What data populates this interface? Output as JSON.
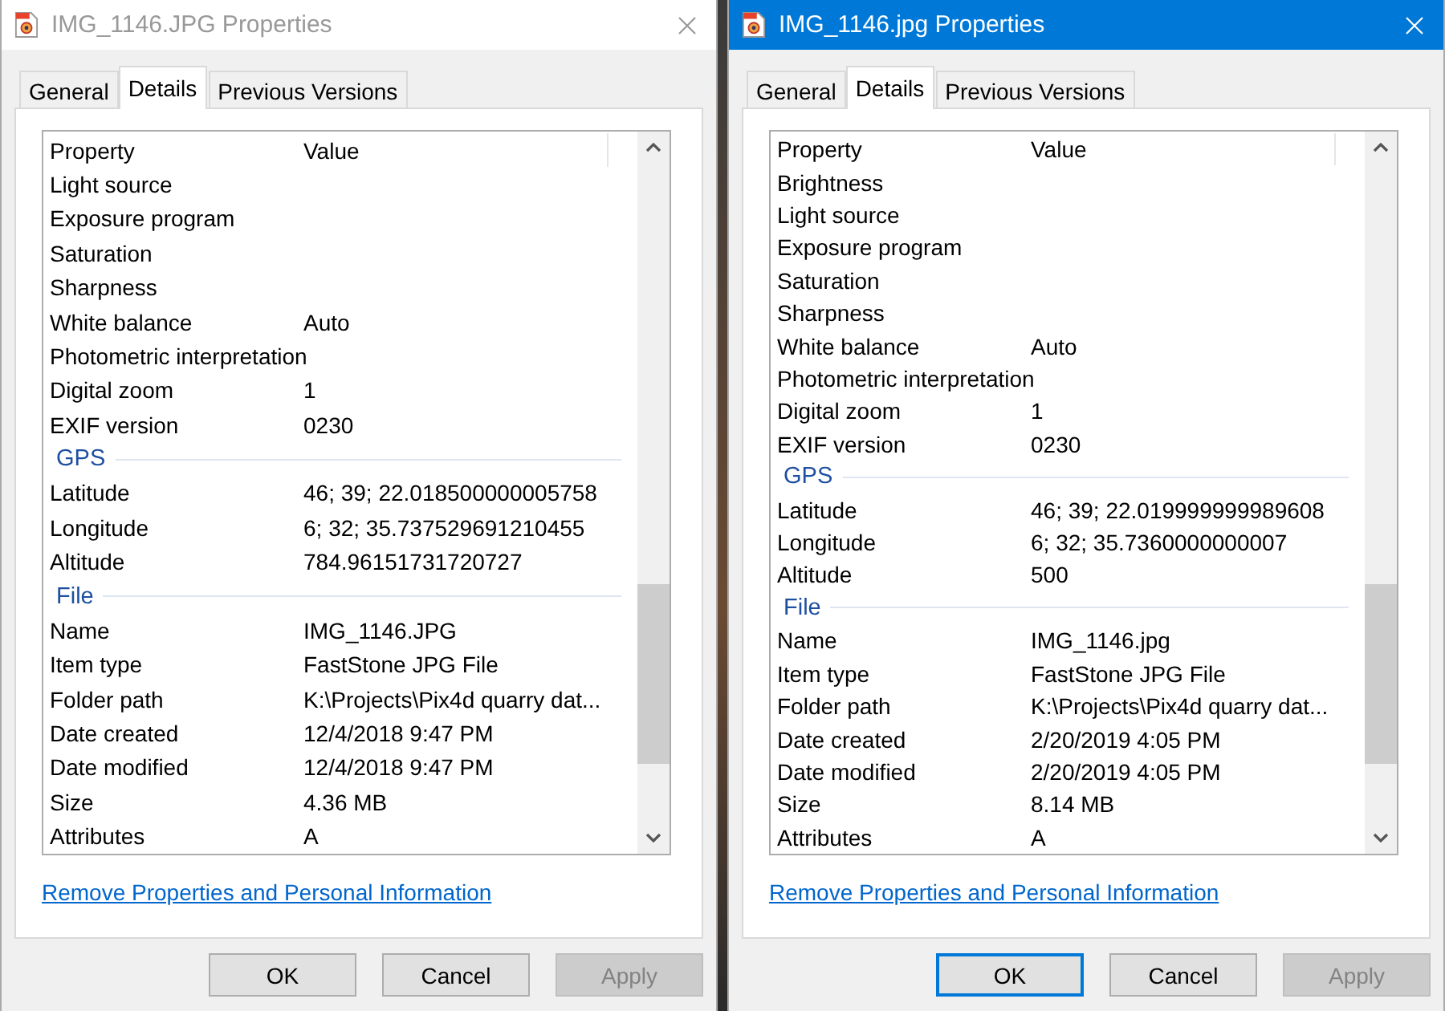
{
  "windows": [
    {
      "title": "IMG_1146.JPG Properties",
      "active": false,
      "tabs": [
        {
          "label": "General",
          "selected": false
        },
        {
          "label": "Details",
          "selected": true
        },
        {
          "label": "Previous Versions",
          "selected": false
        }
      ],
      "columns": [
        "Property",
        "Value"
      ],
      "rows": [
        {
          "kind": "item",
          "property": "Light source",
          "value": ""
        },
        {
          "kind": "item",
          "property": "Exposure program",
          "value": ""
        },
        {
          "kind": "item",
          "property": "Saturation",
          "value": ""
        },
        {
          "kind": "item",
          "property": "Sharpness",
          "value": ""
        },
        {
          "kind": "item",
          "property": "White balance",
          "value": "Auto"
        },
        {
          "kind": "item",
          "property": "Photometric interpretation",
          "value": ""
        },
        {
          "kind": "item",
          "property": "Digital zoom",
          "value": "1"
        },
        {
          "kind": "item",
          "property": "EXIF version",
          "value": "0230"
        },
        {
          "kind": "group",
          "property": "GPS"
        },
        {
          "kind": "item",
          "property": "Latitude",
          "value": "46; 39; 22.018500000005758"
        },
        {
          "kind": "item",
          "property": "Longitude",
          "value": "6; 32; 35.737529691210455"
        },
        {
          "kind": "item",
          "property": "Altitude",
          "value": "784.96151731720727"
        },
        {
          "kind": "group",
          "property": "File"
        },
        {
          "kind": "item",
          "property": "Name",
          "value": "IMG_1146.JPG"
        },
        {
          "kind": "item",
          "property": "Item type",
          "value": "FastStone JPG File"
        },
        {
          "kind": "item",
          "property": "Folder path",
          "value": "K:\\Projects\\Pix4d quarry dat..."
        },
        {
          "kind": "item",
          "property": "Date created",
          "value": "12/4/2018 9:47 PM"
        },
        {
          "kind": "item",
          "property": "Date modified",
          "value": "12/4/2018 9:47 PM"
        },
        {
          "kind": "item",
          "property": "Size",
          "value": "4.36 MB"
        },
        {
          "kind": "item",
          "property": "Attributes",
          "value": "A"
        }
      ],
      "link": "Remove Properties and Personal Information",
      "buttons": [
        {
          "label": "OK",
          "focused": false,
          "disabled": false
        },
        {
          "label": "Cancel",
          "focused": false,
          "disabled": false
        },
        {
          "label": "Apply",
          "focused": false,
          "disabled": true
        }
      ]
    },
    {
      "title": "IMG_1146.jpg Properties",
      "active": true,
      "tabs": [
        {
          "label": "General",
          "selected": false
        },
        {
          "label": "Details",
          "selected": true
        },
        {
          "label": "Previous Versions",
          "selected": false
        }
      ],
      "columns": [
        "Property",
        "Value"
      ],
      "rows": [
        {
          "kind": "item",
          "property": "Brightness",
          "value": ""
        },
        {
          "kind": "item",
          "property": "Light source",
          "value": ""
        },
        {
          "kind": "item",
          "property": "Exposure program",
          "value": ""
        },
        {
          "kind": "item",
          "property": "Saturation",
          "value": ""
        },
        {
          "kind": "item",
          "property": "Sharpness",
          "value": ""
        },
        {
          "kind": "item",
          "property": "White balance",
          "value": "Auto"
        },
        {
          "kind": "item",
          "property": "Photometric interpretation",
          "value": ""
        },
        {
          "kind": "item",
          "property": "Digital zoom",
          "value": "1"
        },
        {
          "kind": "item",
          "property": "EXIF version",
          "value": "0230"
        },
        {
          "kind": "group",
          "property": "GPS"
        },
        {
          "kind": "item",
          "property": "Latitude",
          "value": "46; 39; 22.019999999989608"
        },
        {
          "kind": "item",
          "property": "Longitude",
          "value": "6; 32; 35.7360000000007"
        },
        {
          "kind": "item",
          "property": "Altitude",
          "value": "500"
        },
        {
          "kind": "group",
          "property": "File"
        },
        {
          "kind": "item",
          "property": "Name",
          "value": "IMG_1146.jpg"
        },
        {
          "kind": "item",
          "property": "Item type",
          "value": "FastStone JPG File"
        },
        {
          "kind": "item",
          "property": "Folder path",
          "value": "K:\\Projects\\Pix4d quarry dat..."
        },
        {
          "kind": "item",
          "property": "Date created",
          "value": "2/20/2019 4:05 PM"
        },
        {
          "kind": "item",
          "property": "Date modified",
          "value": "2/20/2019 4:05 PM"
        },
        {
          "kind": "item",
          "property": "Size",
          "value": "8.14 MB"
        },
        {
          "kind": "item",
          "property": "Attributes",
          "value": "A"
        }
      ],
      "link": "Remove Properties and Personal Information",
      "buttons": [
        {
          "label": "OK",
          "focused": true,
          "disabled": false
        },
        {
          "label": "Cancel",
          "focused": false,
          "disabled": false
        },
        {
          "label": "Apply",
          "focused": false,
          "disabled": true
        }
      ]
    }
  ]
}
